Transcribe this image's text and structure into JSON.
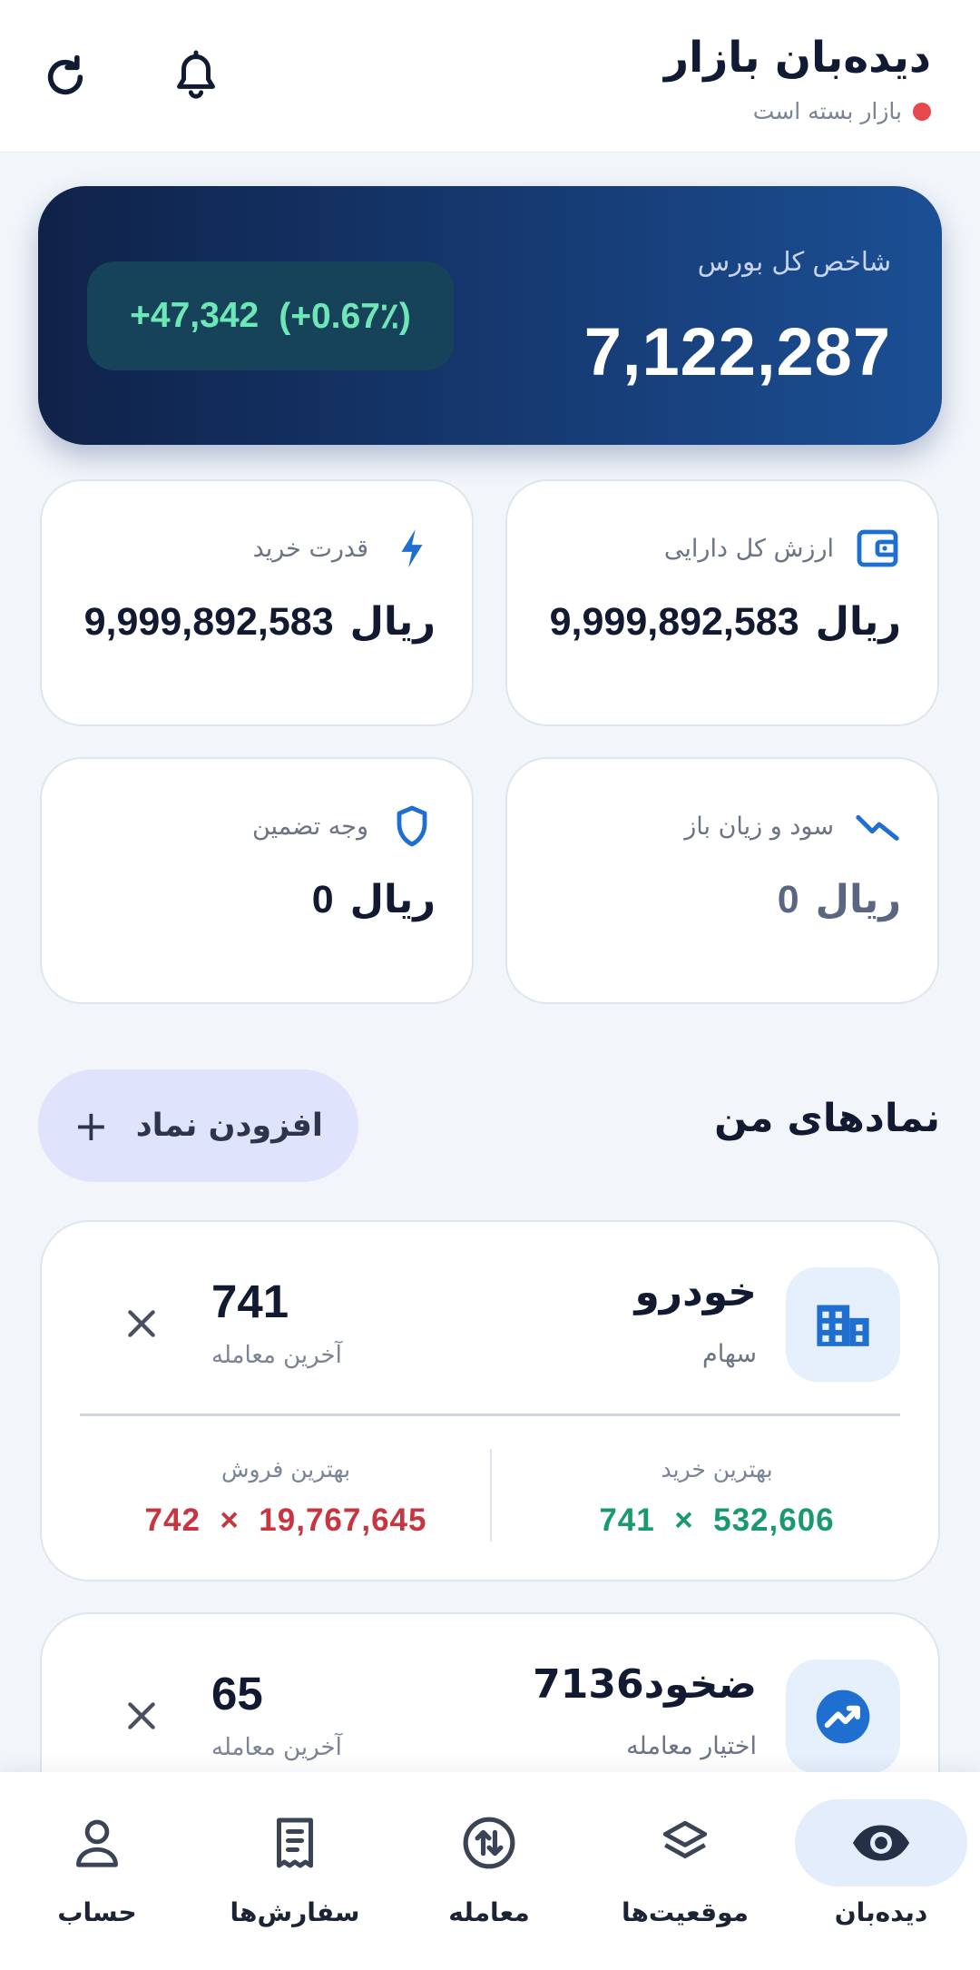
{
  "header": {
    "title": "دیده‌بان بازار",
    "market_status": "بازار بسته است",
    "icons": [
      "bell-icon",
      "refresh-icon"
    ]
  },
  "index_card": {
    "label": "شاخص کل بورس",
    "value": "7,122,287",
    "change": "+47,342",
    "change_percent": "(+0.67٪)"
  },
  "stats": {
    "total_assets": {
      "label": "ارزش کل دارایی",
      "currency": "ریال",
      "value": "9,999,892,583",
      "icon": "wallet-icon"
    },
    "buying_power": {
      "label": "قدرت خرید",
      "currency": "ریال",
      "value": "9,999,892,583",
      "icon": "lightning-icon"
    },
    "open_pnl": {
      "label": "سود و زیان باز",
      "currency": "ریال",
      "value": "0",
      "icon": "trend-down-icon"
    },
    "margin": {
      "label": "وجه تضمین",
      "currency": "ریال",
      "value": "0",
      "icon": "shield-icon"
    }
  },
  "section": {
    "title": "نمادهای من",
    "add_button": "افزودن نماد"
  },
  "symbols": [
    {
      "name": "خودرو",
      "type": "سهام",
      "last_price": "741",
      "last_label": "آخرین معامله",
      "best_buy_label": "بهترین خرید",
      "best_buy_price": "741",
      "best_buy_qty": "532,606",
      "best_sell_label": "بهترین فروش",
      "best_sell_price": "742",
      "best_sell_qty": "19,767,645",
      "times": "×",
      "icon": "building-icon"
    },
    {
      "name": "ضخود7136",
      "type": "اختیار معامله",
      "last_price": "65",
      "last_label": "آخرین معامله",
      "icon": "trending-up-icon"
    }
  ],
  "nav": {
    "watch": "دیده‌بان",
    "positions": "موقعیت‌ها",
    "trade": "معامله",
    "orders": "سفارش‌ها",
    "account": "حساب"
  },
  "colors": {
    "accent": "#1f6fd1",
    "positive": "#1a9a6c",
    "negative": "#c9353f",
    "status_closed": "#e5484d"
  }
}
